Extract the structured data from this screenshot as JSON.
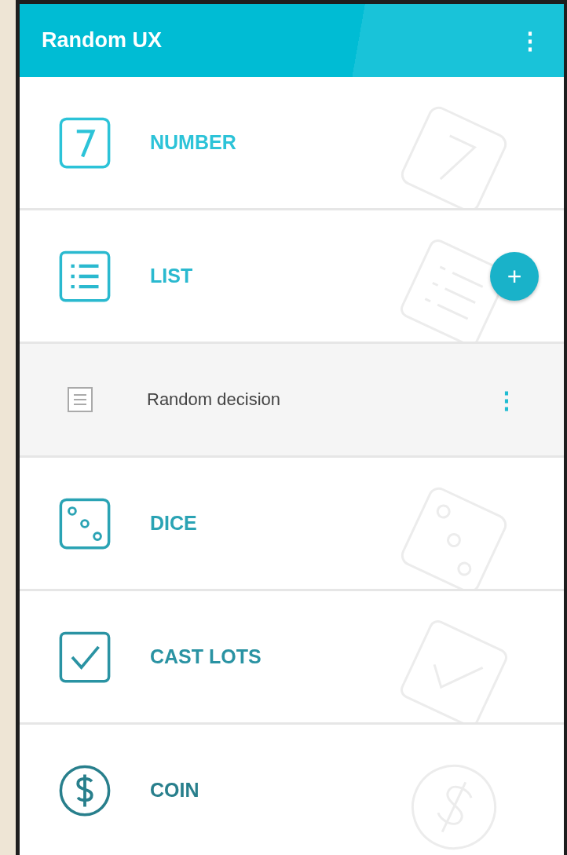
{
  "app_bar": {
    "title": "Random UX",
    "menu": "⋮"
  },
  "items": [
    {
      "kind": "number",
      "label": "NUMBER",
      "color": "#2cc3d8"
    },
    {
      "kind": "list",
      "label": "LIST",
      "color": "#2ab9cf",
      "add": "+"
    },
    {
      "kind": "entry",
      "label": "Random decision",
      "menu": "⋮"
    },
    {
      "kind": "dice",
      "label": "DICE",
      "color": "#2aa3b4"
    },
    {
      "kind": "check",
      "label": "CAST LOTS",
      "color": "#2a93a3"
    },
    {
      "kind": "coin",
      "label": "COIN",
      "color": "#287f8c"
    }
  ]
}
